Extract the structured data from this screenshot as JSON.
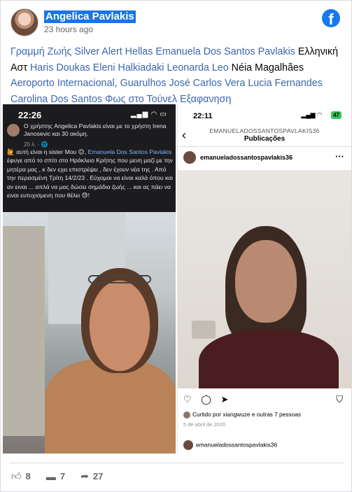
{
  "post": {
    "author": "Angelica Pavlakis",
    "time": "23 hours ago",
    "text_segments": [
      {
        "text": "Γραμμή Ζωής Silver Alert Hellas Emanuela Dos Santos Pavlakis",
        "link": true
      },
      {
        "text": " Ελληνική Αστ ",
        "link": false
      },
      {
        "text": "Haris Doukas Eleni Halkiadaki Leonarda Leo",
        "link": true
      },
      {
        "text": " Néia Magalhães ",
        "link": false
      },
      {
        "text": "Aeroporto Internacional, Guarulhos José Carlos Vera Lucia Fernandes Carolina Dos Santos Φως στο Τούνελ Εξαφανηση",
        "link": true
      }
    ]
  },
  "left_screenshot": {
    "clock": "22:26",
    "notice": "Ο χρήστης Angelica Pavlakis είναι με το χρήστη Irena Janosevic και 30 ακόμη.",
    "notice_meta": "20 λ. · 🌐",
    "caption_intro": "🙋 αυτή είναι η sister Μου 😊,",
    "caption_name": "Emanuela Dos Santos Pavlakis",
    "caption_rest": "έφυγε από το σπίτι στο Ηράκλειο Κρήτης που μενη μαζί με την μητέρα μας , κ δεν εχει επιστρέψει , δεν έχουν νέα της . Από την περασμένη Τρίτη 14/2/23 . Εύχομαι να είναι καλά όπου και αν ειναι ... απλά να μας δώσει σημάδια ζωής ... και ας πάει να ειναι ευτυχισμενη που θέλει 😓!"
  },
  "right_screenshot": {
    "clock": "22:11",
    "battery": "47",
    "profile_handle": "EMANUELADOSSANTOSPAVLAKIS36",
    "section_title": "Publicações",
    "post_user": "emanueladossantospavlakis36",
    "likes": "Curtido por xiangwuze e outras 7 pessoas",
    "date": "5 de abril de 2020",
    "next_user": "emanueladossantospavlakis36"
  },
  "footer": {
    "likes": "8",
    "comments": "7",
    "shares": "27"
  },
  "icons": {
    "facebook": "facebook-icon",
    "like": "thumbs-up-icon",
    "comment": "comment-icon",
    "share": "share-icon"
  },
  "colors": {
    "link": "#3a67b0",
    "facebook_blue": "#1877f2",
    "highlight": "#1a73e8"
  }
}
